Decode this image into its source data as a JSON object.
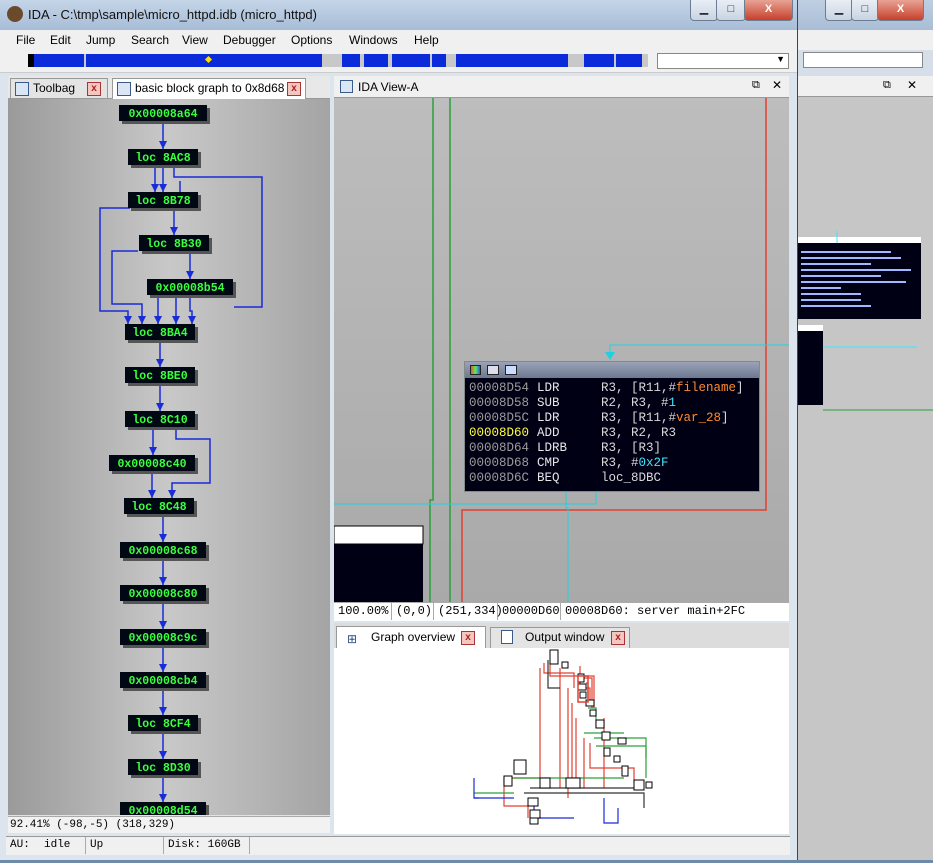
{
  "window": {
    "title": "IDA - C:\\tmp\\sample\\micro_httpd.idb (micro_httpd)",
    "buttons": {
      "minimize": "▁",
      "maximize": "□",
      "close": "X"
    }
  },
  "menu": [
    "File",
    "Edit",
    "Jump",
    "Search",
    "View",
    "Debugger",
    "Options",
    "Windows",
    "Help"
  ],
  "left_tabs": [
    {
      "label": "Toolbag"
    },
    {
      "label": "basic block graph to 0x8d68"
    }
  ],
  "block_graph": {
    "nodes": [
      "0x00008a64",
      "loc 8AC8",
      "loc 8B78",
      "loc 8B30",
      "0x00008b54",
      "loc 8BA4",
      "loc 8BE0",
      "loc 8C10",
      "0x00008c40",
      "loc 8C48",
      "0x00008c68",
      "0x00008c80",
      "0x00008c9c",
      "0x00008cb4",
      "loc 8CF4",
      "loc 8D30",
      "0x00008d54"
    ],
    "status": "92.41% (-98,-5)  (318,329)"
  },
  "ida_view": {
    "title": "IDA View-A",
    "code": [
      {
        "addr": "00008D54",
        "mn": "LDR",
        "ops": [
          {
            "t": "R3, [R11,#",
            "c": "p"
          },
          {
            "t": "filename",
            "c": "v"
          },
          {
            "t": "]",
            "c": "p"
          }
        ]
      },
      {
        "addr": "00008D58",
        "mn": "SUB",
        "ops": [
          {
            "t": "R2, R3, #",
            "c": "p"
          },
          {
            "t": "1",
            "c": "n"
          }
        ]
      },
      {
        "addr": "00008D5C",
        "mn": "LDR",
        "ops": [
          {
            "t": "R3, [R11,#",
            "c": "p"
          },
          {
            "t": "var_28",
            "c": "v"
          },
          {
            "t": "]",
            "c": "p"
          }
        ]
      },
      {
        "addr": "00008D60",
        "mn": "ADD",
        "ops": [
          {
            "t": "R3, R2, R3",
            "c": "p"
          }
        ],
        "current": true
      },
      {
        "addr": "00008D64",
        "mn": "LDRB",
        "ops": [
          {
            "t": "R3, [R3]",
            "c": "p"
          }
        ]
      },
      {
        "addr": "00008D68",
        "mn": "CMP",
        "ops": [
          {
            "t": "R3, #",
            "c": "p"
          },
          {
            "t": "0x2F",
            "c": "n"
          }
        ]
      },
      {
        "addr": "00008D6C",
        "mn": "BEQ",
        "ops": [
          {
            "t": "loc_8DBC",
            "c": "p"
          }
        ]
      }
    ],
    "status": {
      "zoom": "100.00%",
      "coords": "(0,0)",
      "mouse": "(251,334)",
      "address": "00000D60",
      "location": "00008D60: server main+2FC"
    }
  },
  "lower_tabs": [
    {
      "label": "Graph overview"
    },
    {
      "label": "Output window"
    }
  ],
  "bottom_status": {
    "au_label": "AU:",
    "au_value": "idle",
    "direction": "Up",
    "disk": "Disk: 160GB"
  },
  "colors": {
    "node_text": "#3cff3c",
    "node_bg": "#000814",
    "edge": "#1a2bd8",
    "edge_red": "#e04030",
    "edge_green": "#2aa03a",
    "edge_cyan": "#20d0e0"
  }
}
